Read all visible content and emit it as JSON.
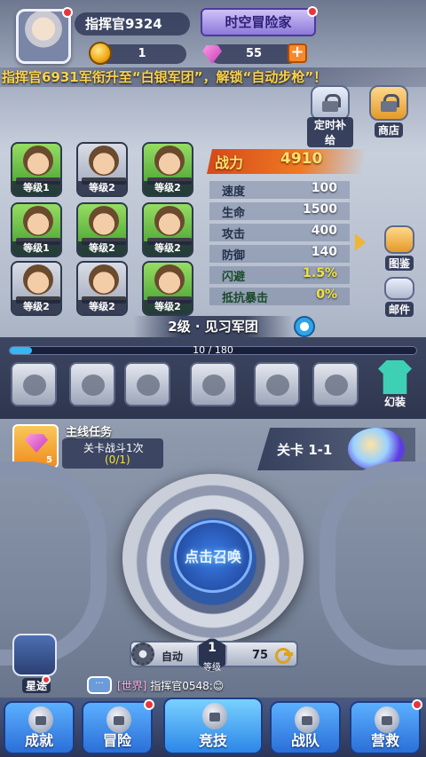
{
  "player": {
    "name": "指挥官9324",
    "game_mode": "时空冒险家",
    "coins": "1",
    "gems": "55",
    "plus": "+"
  },
  "marquee": "指挥官6931军衔升至“白银军团”，解锁“自动步枪”！",
  "top_buttons": {
    "supply": "定时补给",
    "shop": "商店"
  },
  "heroes": [
    {
      "level": "等级1"
    },
    {
      "level": "等级2"
    },
    {
      "level": "等级2"
    },
    {
      "level": "等级1"
    },
    {
      "level": "等级2"
    },
    {
      "level": "等级2"
    },
    {
      "level": "等级2"
    },
    {
      "level": "等级2"
    },
    {
      "level": "等级2"
    }
  ],
  "stats": {
    "power_label": "战力",
    "power_value": "4910",
    "rows": [
      {
        "label": "速度",
        "value": "100"
      },
      {
        "label": "生命",
        "value": "1500"
      },
      {
        "label": "攻击",
        "value": "400"
      },
      {
        "label": "防御",
        "value": "140"
      },
      {
        "label": "闪避",
        "value": "1.5%"
      },
      {
        "label": "抵抗暴击",
        "value": "0%"
      }
    ]
  },
  "side_right": {
    "illustrated": "图鉴",
    "mail": "邮件"
  },
  "rank": "2级 · 见习军团",
  "xp": {
    "text": "10 / 180",
    "fraction": 0.0556
  },
  "outfit_label": "幻装",
  "mission": {
    "title": "主线任务",
    "desc": "关卡战斗1次",
    "progress": "(0/1)",
    "reward_count": "5"
  },
  "stage": "关卡 1-1",
  "summon_label": "点击召唤",
  "auto": {
    "label": "自动",
    "level_num": "1",
    "level_label": "等级",
    "keys": "75"
  },
  "xingtu_label": "星途",
  "chat": {
    "channel": "[世界]",
    "sender": "指挥官0548:",
    "emoji": "😊",
    "icon": "···"
  },
  "nav": [
    {
      "label": "成就"
    },
    {
      "label": "冒险"
    },
    {
      "label": "竞技"
    },
    {
      "label": "战队"
    },
    {
      "label": "营救"
    }
  ],
  "colors": {
    "accent_blue": "#2b6fd8",
    "power_orange": "#f07a22",
    "gold": "#ffe36e",
    "alert_red": "#e7353b"
  }
}
